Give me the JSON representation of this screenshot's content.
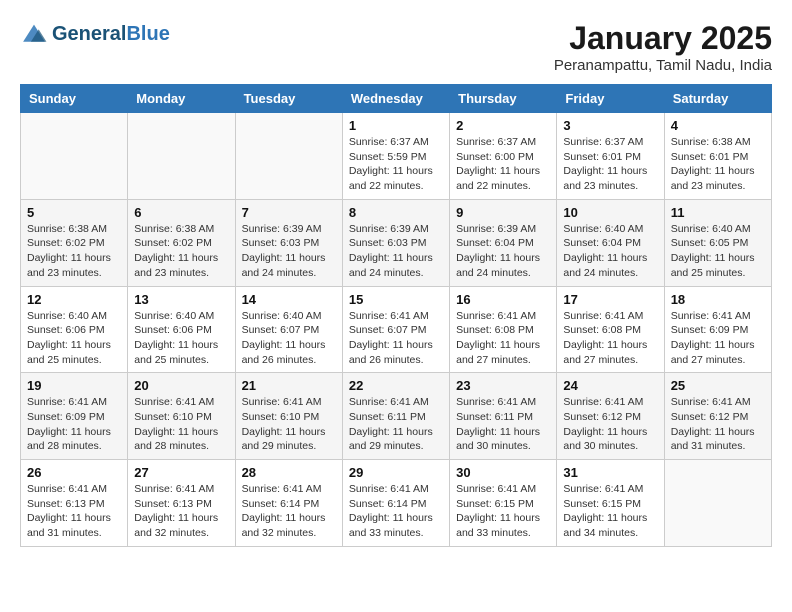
{
  "header": {
    "logo_line1": "General",
    "logo_line2": "Blue",
    "month": "January 2025",
    "location": "Peranampattu, Tamil Nadu, India"
  },
  "weekdays": [
    "Sunday",
    "Monday",
    "Tuesday",
    "Wednesday",
    "Thursday",
    "Friday",
    "Saturday"
  ],
  "weeks": [
    [
      {
        "day": "",
        "sunrise": "",
        "sunset": "",
        "daylight": ""
      },
      {
        "day": "",
        "sunrise": "",
        "sunset": "",
        "daylight": ""
      },
      {
        "day": "",
        "sunrise": "",
        "sunset": "",
        "daylight": ""
      },
      {
        "day": "1",
        "sunrise": "Sunrise: 6:37 AM",
        "sunset": "Sunset: 5:59 PM",
        "daylight": "Daylight: 11 hours and 22 minutes."
      },
      {
        "day": "2",
        "sunrise": "Sunrise: 6:37 AM",
        "sunset": "Sunset: 6:00 PM",
        "daylight": "Daylight: 11 hours and 22 minutes."
      },
      {
        "day": "3",
        "sunrise": "Sunrise: 6:37 AM",
        "sunset": "Sunset: 6:01 PM",
        "daylight": "Daylight: 11 hours and 23 minutes."
      },
      {
        "day": "4",
        "sunrise": "Sunrise: 6:38 AM",
        "sunset": "Sunset: 6:01 PM",
        "daylight": "Daylight: 11 hours and 23 minutes."
      }
    ],
    [
      {
        "day": "5",
        "sunrise": "Sunrise: 6:38 AM",
        "sunset": "Sunset: 6:02 PM",
        "daylight": "Daylight: 11 hours and 23 minutes."
      },
      {
        "day": "6",
        "sunrise": "Sunrise: 6:38 AM",
        "sunset": "Sunset: 6:02 PM",
        "daylight": "Daylight: 11 hours and 23 minutes."
      },
      {
        "day": "7",
        "sunrise": "Sunrise: 6:39 AM",
        "sunset": "Sunset: 6:03 PM",
        "daylight": "Daylight: 11 hours and 24 minutes."
      },
      {
        "day": "8",
        "sunrise": "Sunrise: 6:39 AM",
        "sunset": "Sunset: 6:03 PM",
        "daylight": "Daylight: 11 hours and 24 minutes."
      },
      {
        "day": "9",
        "sunrise": "Sunrise: 6:39 AM",
        "sunset": "Sunset: 6:04 PM",
        "daylight": "Daylight: 11 hours and 24 minutes."
      },
      {
        "day": "10",
        "sunrise": "Sunrise: 6:40 AM",
        "sunset": "Sunset: 6:04 PM",
        "daylight": "Daylight: 11 hours and 24 minutes."
      },
      {
        "day": "11",
        "sunrise": "Sunrise: 6:40 AM",
        "sunset": "Sunset: 6:05 PM",
        "daylight": "Daylight: 11 hours and 25 minutes."
      }
    ],
    [
      {
        "day": "12",
        "sunrise": "Sunrise: 6:40 AM",
        "sunset": "Sunset: 6:06 PM",
        "daylight": "Daylight: 11 hours and 25 minutes."
      },
      {
        "day": "13",
        "sunrise": "Sunrise: 6:40 AM",
        "sunset": "Sunset: 6:06 PM",
        "daylight": "Daylight: 11 hours and 25 minutes."
      },
      {
        "day": "14",
        "sunrise": "Sunrise: 6:40 AM",
        "sunset": "Sunset: 6:07 PM",
        "daylight": "Daylight: 11 hours and 26 minutes."
      },
      {
        "day": "15",
        "sunrise": "Sunrise: 6:41 AM",
        "sunset": "Sunset: 6:07 PM",
        "daylight": "Daylight: 11 hours and 26 minutes."
      },
      {
        "day": "16",
        "sunrise": "Sunrise: 6:41 AM",
        "sunset": "Sunset: 6:08 PM",
        "daylight": "Daylight: 11 hours and 27 minutes."
      },
      {
        "day": "17",
        "sunrise": "Sunrise: 6:41 AM",
        "sunset": "Sunset: 6:08 PM",
        "daylight": "Daylight: 11 hours and 27 minutes."
      },
      {
        "day": "18",
        "sunrise": "Sunrise: 6:41 AM",
        "sunset": "Sunset: 6:09 PM",
        "daylight": "Daylight: 11 hours and 27 minutes."
      }
    ],
    [
      {
        "day": "19",
        "sunrise": "Sunrise: 6:41 AM",
        "sunset": "Sunset: 6:09 PM",
        "daylight": "Daylight: 11 hours and 28 minutes."
      },
      {
        "day": "20",
        "sunrise": "Sunrise: 6:41 AM",
        "sunset": "Sunset: 6:10 PM",
        "daylight": "Daylight: 11 hours and 28 minutes."
      },
      {
        "day": "21",
        "sunrise": "Sunrise: 6:41 AM",
        "sunset": "Sunset: 6:10 PM",
        "daylight": "Daylight: 11 hours and 29 minutes."
      },
      {
        "day": "22",
        "sunrise": "Sunrise: 6:41 AM",
        "sunset": "Sunset: 6:11 PM",
        "daylight": "Daylight: 11 hours and 29 minutes."
      },
      {
        "day": "23",
        "sunrise": "Sunrise: 6:41 AM",
        "sunset": "Sunset: 6:11 PM",
        "daylight": "Daylight: 11 hours and 30 minutes."
      },
      {
        "day": "24",
        "sunrise": "Sunrise: 6:41 AM",
        "sunset": "Sunset: 6:12 PM",
        "daylight": "Daylight: 11 hours and 30 minutes."
      },
      {
        "day": "25",
        "sunrise": "Sunrise: 6:41 AM",
        "sunset": "Sunset: 6:12 PM",
        "daylight": "Daylight: 11 hours and 31 minutes."
      }
    ],
    [
      {
        "day": "26",
        "sunrise": "Sunrise: 6:41 AM",
        "sunset": "Sunset: 6:13 PM",
        "daylight": "Daylight: 11 hours and 31 minutes."
      },
      {
        "day": "27",
        "sunrise": "Sunrise: 6:41 AM",
        "sunset": "Sunset: 6:13 PM",
        "daylight": "Daylight: 11 hours and 32 minutes."
      },
      {
        "day": "28",
        "sunrise": "Sunrise: 6:41 AM",
        "sunset": "Sunset: 6:14 PM",
        "daylight": "Daylight: 11 hours and 32 minutes."
      },
      {
        "day": "29",
        "sunrise": "Sunrise: 6:41 AM",
        "sunset": "Sunset: 6:14 PM",
        "daylight": "Daylight: 11 hours and 33 minutes."
      },
      {
        "day": "30",
        "sunrise": "Sunrise: 6:41 AM",
        "sunset": "Sunset: 6:15 PM",
        "daylight": "Daylight: 11 hours and 33 minutes."
      },
      {
        "day": "31",
        "sunrise": "Sunrise: 6:41 AM",
        "sunset": "Sunset: 6:15 PM",
        "daylight": "Daylight: 11 hours and 34 minutes."
      },
      {
        "day": "",
        "sunrise": "",
        "sunset": "",
        "daylight": ""
      }
    ]
  ]
}
